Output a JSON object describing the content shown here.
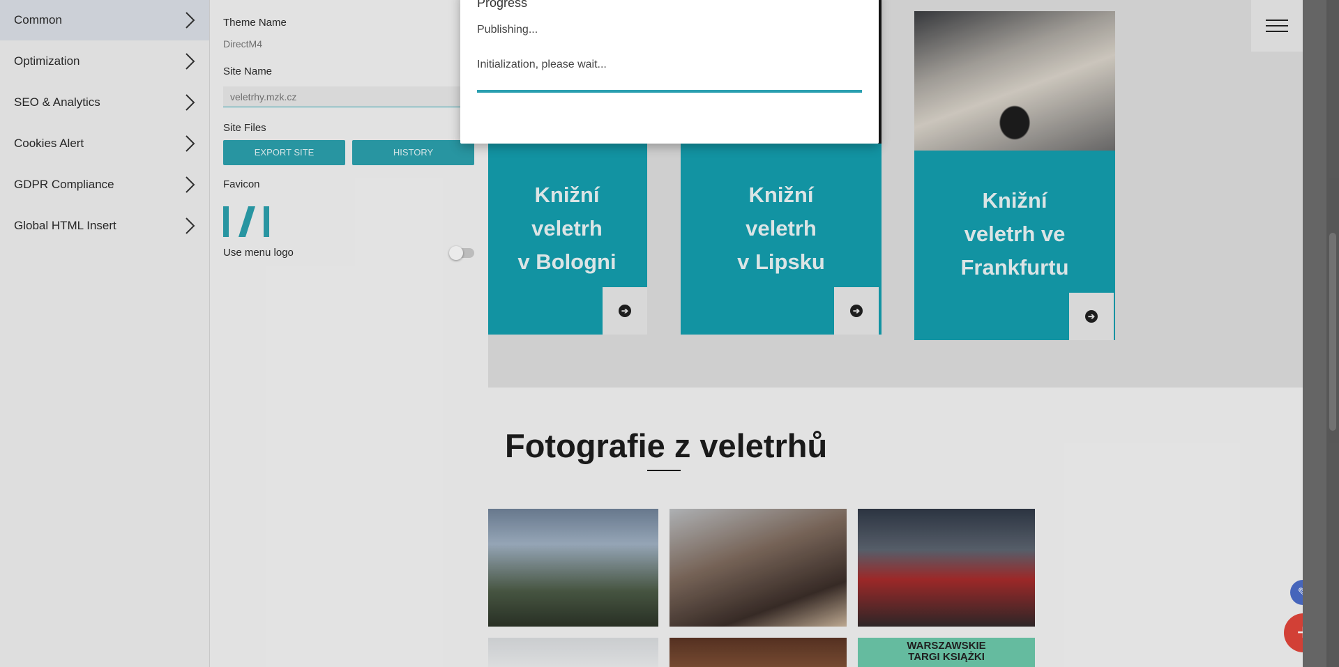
{
  "sidebar": {
    "items": [
      {
        "label": "Common",
        "active": true
      },
      {
        "label": "Optimization"
      },
      {
        "label": "SEO & Analytics"
      },
      {
        "label": "Cookies Alert"
      },
      {
        "label": "GDPR Compliance"
      },
      {
        "label": "Global HTML Insert"
      }
    ]
  },
  "panel": {
    "theme_name_label": "Theme Name",
    "theme_name_value": "DirectM4",
    "site_name_label": "Site Name",
    "site_name_placeholder": "veletrhy.mzk.cz",
    "site_files_label": "Site Files",
    "export_button": "EXPORT SITE",
    "history_button": "HISTORY",
    "favicon_label": "Favicon",
    "use_menu_logo_label": "Use menu logo",
    "use_menu_logo_enabled": false
  },
  "modal": {
    "title": "Progress",
    "status": "Publishing...",
    "message": "Initialization, please wait...",
    "progress": 1.0
  },
  "page": {
    "cards": [
      {
        "title": "Knižní\nveletrh\nv Bologni"
      },
      {
        "title": "Knižní\nveletrh\nv Lipsku"
      },
      {
        "title": "Knižní\nveletrh ve\nFrankfurtu"
      }
    ],
    "photos_title": "Fotografie z veletrhů",
    "banner_text": "WARSZAWSKIE\nTARGI KSIĄŻKI",
    "arrow_glyph": "➔",
    "edit_glyph": "✎",
    "add_glyph": "+"
  },
  "colors": {
    "accent": "#2b9fac",
    "card": "#149dad",
    "fab_add": "#e0453a",
    "fab_edit": "#4b6cc7"
  }
}
